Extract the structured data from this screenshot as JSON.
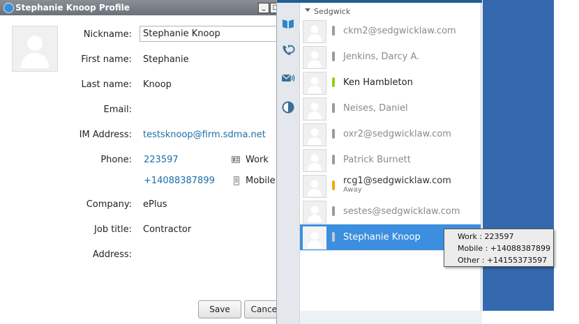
{
  "window": {
    "title": "Stephanie Knoop Profile",
    "minimize_glyph": "_",
    "maximize_glyph": "□"
  },
  "profile": {
    "labels": {
      "nickname": "Nickname:",
      "first_name": "First name:",
      "last_name": "Last name:",
      "email": "Email:",
      "im_address": "IM Address:",
      "phone": "Phone:",
      "company": "Company:",
      "job_title": "Job title:",
      "address": "Address:"
    },
    "nickname": "Stephanie Knoop",
    "first_name": "Stephanie",
    "last_name": "Knoop",
    "email": "",
    "im_address": "testsknoop@firm.sdma.net",
    "phones": [
      {
        "number": "223597",
        "type": "Work",
        "icon": "work-phone-icon"
      },
      {
        "number": "+14088387899",
        "type": "Mobile",
        "icon": "mobile-phone-icon"
      }
    ],
    "company": "ePlus",
    "job_title": "Contractor",
    "address": "",
    "buttons": {
      "save": "Save",
      "cancel": "Cancel"
    }
  },
  "rail": {
    "icons": [
      "contacts-book-icon",
      "call-history-icon",
      "voicemail-icon",
      "presence-icon"
    ]
  },
  "contacts": {
    "group": "Sedgwick",
    "items": [
      {
        "name": "ckm2@sedgwicklaw.com",
        "status": "",
        "presence": "#9a9a9a",
        "available": false,
        "selected": false
      },
      {
        "name": "Jenkins, Darcy A.",
        "status": "",
        "presence": "#9a9a9a",
        "available": false,
        "selected": false
      },
      {
        "name": "Ken Hambleton",
        "status": "",
        "presence": "#8fd11b",
        "available": true,
        "selected": false
      },
      {
        "name": "Neises, Daniel",
        "status": "",
        "presence": "#9a9a9a",
        "available": false,
        "selected": false
      },
      {
        "name": "oxr2@sedgwicklaw.com",
        "status": "",
        "presence": "#9a9a9a",
        "available": false,
        "selected": false
      },
      {
        "name": "Patrick Burnett",
        "status": "",
        "presence": "#9a9a9a",
        "available": false,
        "selected": false
      },
      {
        "name": "rcg1@sedgwicklaw.com",
        "status": "Away",
        "presence": "#f2a900",
        "available": true,
        "selected": false
      },
      {
        "name": "sestes@sedgwicklaw.com",
        "status": "",
        "presence": "#9a9a9a",
        "available": false,
        "selected": false
      },
      {
        "name": "Stephanie Knoop",
        "status": "",
        "presence": "#c9c9c9",
        "available": true,
        "selected": true
      }
    ]
  },
  "tooltip": {
    "lines": [
      "Work : 223597",
      "Mobile : +14088387899",
      "Other : +14155373597"
    ]
  },
  "colors": {
    "accent": "#3c8fde",
    "titlebar": "#7b8088",
    "side_pane": "#3469b0",
    "link": "#1a6ea8"
  }
}
